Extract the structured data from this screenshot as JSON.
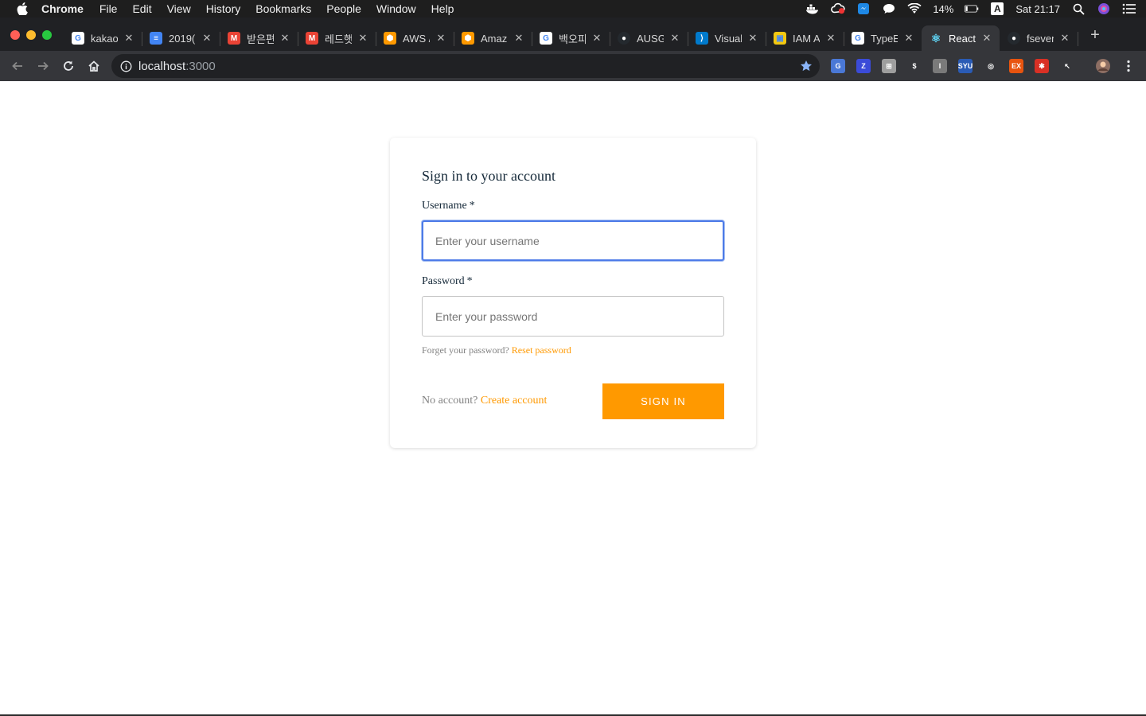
{
  "menubar": {
    "app_name": "Chrome",
    "items": [
      "File",
      "Edit",
      "View",
      "History",
      "Bookmarks",
      "People",
      "Window",
      "Help"
    ],
    "battery": "14%",
    "clock": "Sat 21:17",
    "input_source": "A"
  },
  "tabs": [
    {
      "title": "kakao",
      "icon": "google-icon",
      "color": "#ffffff"
    },
    {
      "title": "2019(",
      "icon": "docs-icon",
      "color": "#4285f4"
    },
    {
      "title": "받은편",
      "icon": "gmail-icon",
      "color": "#ea4335"
    },
    {
      "title": "레드햇",
      "icon": "gmail-icon",
      "color": "#ea4335"
    },
    {
      "title": "AWS /",
      "icon": "aws-icon",
      "color": "#ff9900"
    },
    {
      "title": "Amaz",
      "icon": "aws-icon",
      "color": "#ff9900"
    },
    {
      "title": "백오피",
      "icon": "google-icon",
      "color": "#ffffff"
    },
    {
      "title": "AUSG",
      "icon": "github-icon",
      "color": "#24292e"
    },
    {
      "title": "Visual",
      "icon": "vscode-icon",
      "color": "#007acc"
    },
    {
      "title": "IAM A",
      "icon": "aws-iam-icon",
      "color": "#f2c811"
    },
    {
      "title": "TypeE",
      "icon": "google-icon",
      "color": "#ffffff"
    },
    {
      "title": "React",
      "icon": "react-icon",
      "color": "#61dafb",
      "active": true
    },
    {
      "title": "fseven",
      "icon": "github-icon",
      "color": "#24292e"
    }
  ],
  "toolbar": {
    "url_host": "localhost",
    "url_port": ":3000"
  },
  "extensions": [
    {
      "icon": "translate-icon",
      "color": "#4a78d6",
      "text": "G"
    },
    {
      "icon": "z-icon",
      "color": "#3b4bd8",
      "text": "Z"
    },
    {
      "icon": "ext-grid-icon",
      "color": "#9e9e9e",
      "text": "⊞"
    },
    {
      "icon": "dollar-icon",
      "color": "#35363a",
      "text": "$"
    },
    {
      "icon": "i-icon",
      "color": "#7a7a7a",
      "text": "I"
    },
    {
      "icon": "syu-icon",
      "color": "#2a5bb5",
      "text": "SYU"
    },
    {
      "icon": "target-icon",
      "color": "#35363a",
      "text": "◎"
    },
    {
      "icon": "ex-icon",
      "color": "#e8540f",
      "text": "EX"
    },
    {
      "icon": "puzzle-red-icon",
      "color": "#d93025",
      "text": "✱"
    },
    {
      "icon": "cursor-icon",
      "color": "#35363a",
      "text": "↖"
    }
  ],
  "signin": {
    "title": "Sign in to your account",
    "username_label": "Username",
    "username_required": "*",
    "username_placeholder": "Enter your username",
    "password_label": "Password",
    "password_required": "*",
    "password_placeholder": "Enter your password",
    "forgot_text": "Forget your password?",
    "reset_link": "Reset password",
    "no_account_text": "No account?",
    "create_link": "Create account",
    "submit_label": "SIGN IN"
  },
  "colors": {
    "accent": "#ff9900",
    "focus": "#4d7be8",
    "text": "#152939",
    "muted": "#828282"
  }
}
